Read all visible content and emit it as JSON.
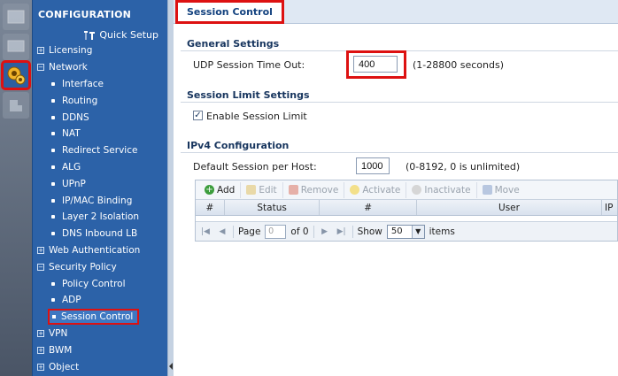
{
  "nav": {
    "title": "CONFIGURATION",
    "quick_setup": "Quick Setup",
    "items": [
      {
        "label": "Licensing",
        "level": 0,
        "expand": "+"
      },
      {
        "label": "Network",
        "level": 0,
        "expand": "−"
      },
      {
        "label": "Interface",
        "level": 1
      },
      {
        "label": "Routing",
        "level": 1
      },
      {
        "label": "DDNS",
        "level": 1
      },
      {
        "label": "NAT",
        "level": 1
      },
      {
        "label": "Redirect Service",
        "level": 1
      },
      {
        "label": "ALG",
        "level": 1
      },
      {
        "label": "UPnP",
        "level": 1
      },
      {
        "label": "IP/MAC Binding",
        "level": 1
      },
      {
        "label": "Layer 2 Isolation",
        "level": 1
      },
      {
        "label": "DNS Inbound LB",
        "level": 1
      },
      {
        "label": "Web Authentication",
        "level": 0,
        "expand": "+"
      },
      {
        "label": "Security Policy",
        "level": 0,
        "expand": "−"
      },
      {
        "label": "Policy Control",
        "level": 1
      },
      {
        "label": "ADP",
        "level": 1
      },
      {
        "label": "Session Control",
        "level": 1,
        "selected": true
      },
      {
        "label": "VPN",
        "level": 0,
        "expand": "+"
      },
      {
        "label": "BWM",
        "level": 0,
        "expand": "+"
      },
      {
        "label": "Object",
        "level": 0,
        "expand": "+"
      }
    ]
  },
  "tab": {
    "label": "Session Control"
  },
  "general": {
    "heading": "General Settings",
    "udp_label": "UDP Session Time Out:",
    "udp_value": "400",
    "udp_hint": "(1-28800 seconds)"
  },
  "limit": {
    "heading": "Session Limit Settings",
    "enable_label": "Enable Session Limit",
    "enabled_mark": "✓"
  },
  "ipv4": {
    "heading": "IPv4 Configuration",
    "default_label": "Default Session per Host:",
    "default_value": "1000",
    "default_hint": "(0-8192, 0 is unlimited)"
  },
  "table": {
    "toolbar": {
      "add": "Add",
      "edit": "Edit",
      "remove": "Remove",
      "activate": "Activate",
      "inactivate": "Inactivate",
      "move": "Move"
    },
    "columns": [
      "#",
      "Status",
      "#",
      "User",
      "IP"
    ],
    "pager": {
      "page_label": "Page",
      "page_value": "0",
      "of_label": "of 0",
      "show_label": "Show",
      "per_page": "50",
      "items_label": "items"
    }
  },
  "colors": {
    "accent": "#2c62a8",
    "highlight": "#dd1111"
  }
}
